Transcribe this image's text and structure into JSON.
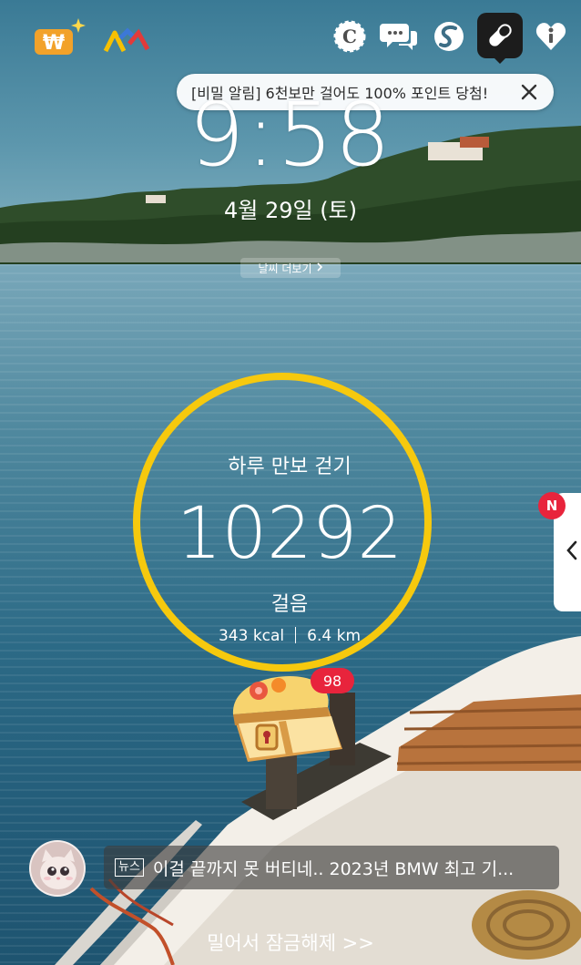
{
  "top_icons": [
    "won-coin-icon",
    "rainbow-icon",
    "coin-c-icon",
    "chat-bubbles-icon",
    "s-swirl-icon",
    "pill-icon",
    "info-heart-icon"
  ],
  "toast": {
    "text": "[비밀 알림] 6천보만 걸어도 100% 포인트 당첨!"
  },
  "clock": {
    "time": "9:58",
    "date": "4월 29일 (토)"
  },
  "weather": {
    "label": "날씨 더보기"
  },
  "pedometer": {
    "title": "하루 만보 걷기",
    "steps": "10292",
    "unit": "걸음",
    "kcal": "343 kcal",
    "distance": "6.4 km",
    "ring_color": "#f6c90e"
  },
  "chest": {
    "badge": "98"
  },
  "side_panel": {
    "badge": "N"
  },
  "news": {
    "tag": "뉴스",
    "headline": "이걸 끝까지 못 버티네.. 2023년 BMW 최고 기..."
  },
  "unlock": {
    "label": "밀어서 잠금해제 >>"
  }
}
